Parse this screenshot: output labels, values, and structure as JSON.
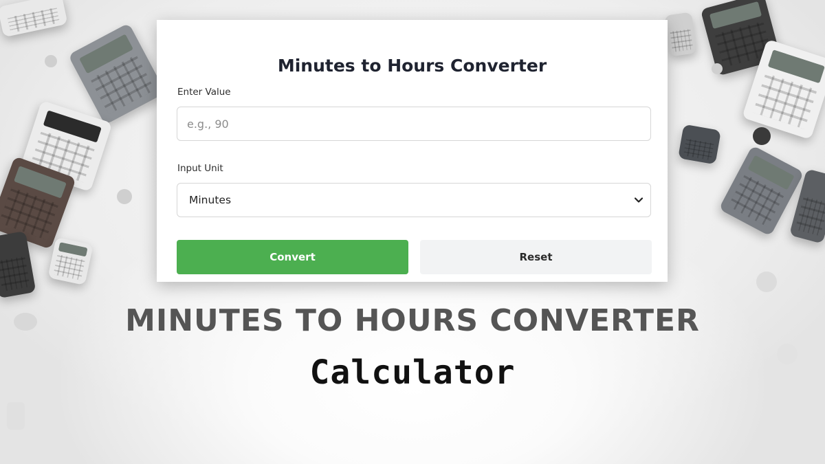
{
  "converter": {
    "title": "Minutes to Hours Converter",
    "value_label": "Enter Value",
    "value_input": {
      "value": "",
      "placeholder": "e.g., 90"
    },
    "unit_label": "Input Unit",
    "unit_select": {
      "selected": "Minutes"
    },
    "convert_label": "Convert",
    "reset_label": "Reset"
  },
  "banner": {
    "headline": "MINUTES TO HOURS CONVERTER",
    "subheadline": "Calculator"
  },
  "colors": {
    "convert_button": "#4caf50",
    "reset_button": "#f2f3f4",
    "headline": "#555555",
    "title": "#1f2330"
  },
  "icons": {
    "select_arrow": "chevron-down-icon"
  }
}
